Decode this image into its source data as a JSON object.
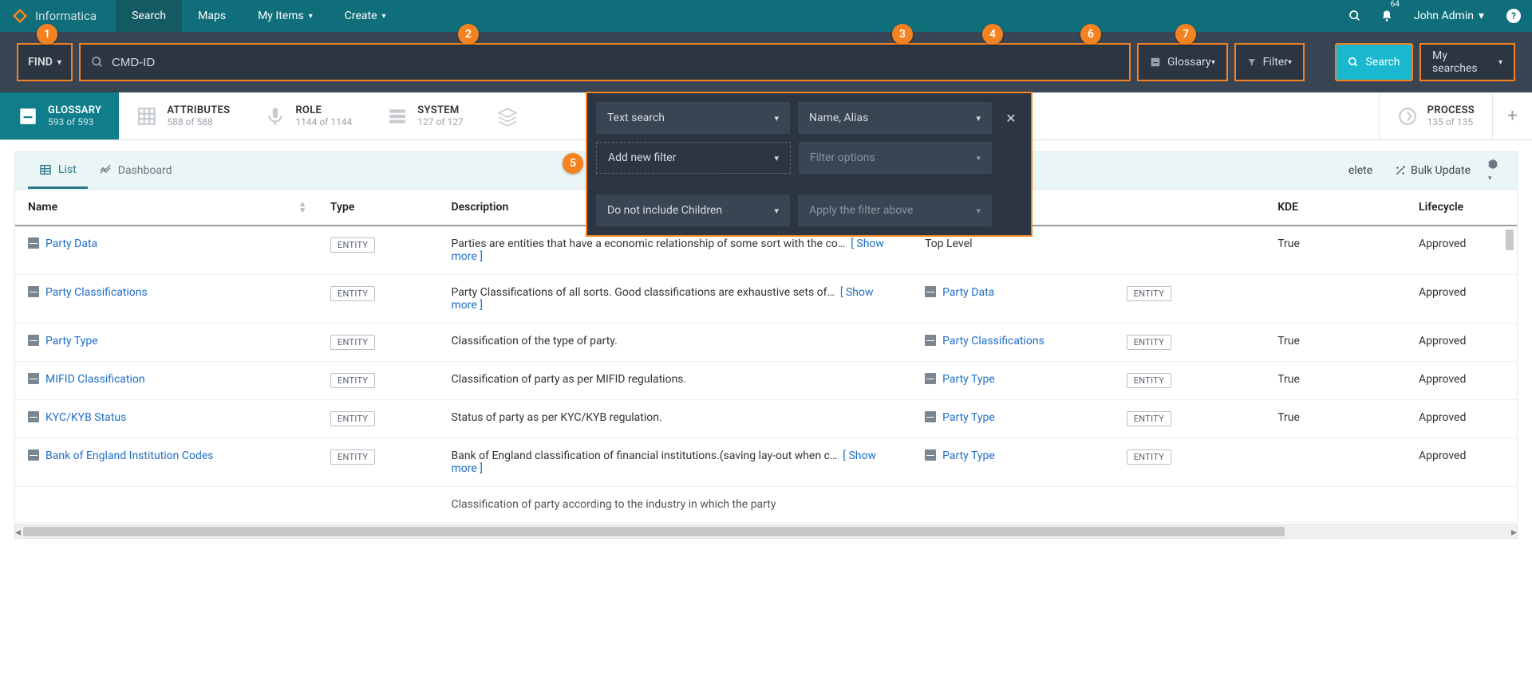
{
  "brand": "Informatica",
  "nav": {
    "search": "Search",
    "maps": "Maps",
    "myitems": "My Items",
    "create": "Create"
  },
  "notif_count": "64",
  "user_name": "John Admin",
  "searchbar": {
    "find": "FIND",
    "input_value": "CMD-ID",
    "glossary": "Glossary",
    "filter": "Filter",
    "search": "Search",
    "mysearches": "My searches"
  },
  "callouts": {
    "c1": "1",
    "c2": "2",
    "c3": "3",
    "c4": "4",
    "c5": "5",
    "c6": "6",
    "c7": "7"
  },
  "cats": {
    "glossary": {
      "title": "GLOSSARY",
      "sub": "593 of 593"
    },
    "attributes": {
      "title": "ATTRIBUTES",
      "sub": "588 of 588"
    },
    "role": {
      "title": "ROLE",
      "sub": "1144 of 1144"
    },
    "system": {
      "title": "SYSTEM",
      "sub": "127 of 127"
    },
    "process": {
      "title": "PROCESS",
      "sub": "135 of 135"
    }
  },
  "filter_panel": {
    "text_search": "Text search",
    "name_alias": "Name, Alias",
    "add_new_filter": "Add new filter",
    "filter_options": "Filter options",
    "do_not_include": "Do not include Children",
    "apply": "Apply the filter above"
  },
  "tabs": {
    "list": "List",
    "dashboard": "Dashboard",
    "delete": "elete",
    "bulk": "Bulk Update"
  },
  "cols": {
    "name": "Name",
    "type": "Type",
    "desc": "Description",
    "parent": "",
    "ptype": "",
    "kde": "KDE",
    "life": "Lifecycle"
  },
  "entity_label": "ENTITY",
  "showmore": "[ Show more ]",
  "rows": [
    {
      "name": "Party Data",
      "desc": "Parties are entities that have a economic relationship of some sort with the co…",
      "more": true,
      "parent": "Top Level",
      "parent_link": false,
      "ptype": "",
      "kde": "True",
      "life": "Approved"
    },
    {
      "name": "Party Classifications",
      "desc": "Party Classifications of all sorts. Good classifications are exhaustive sets of…",
      "more": true,
      "parent": "Party Data",
      "parent_link": true,
      "ptype": "ENTITY",
      "kde": "",
      "life": "Approved"
    },
    {
      "name": "Party Type",
      "desc": "Classification of the type of party.",
      "more": false,
      "parent": "Party Classifications",
      "parent_link": true,
      "ptype": "ENTITY",
      "kde": "True",
      "life": "Approved"
    },
    {
      "name": "MIFID Classification",
      "desc": "Classification of party as per MIFID regulations.",
      "more": false,
      "parent": "Party Type",
      "parent_link": true,
      "ptype": "ENTITY",
      "kde": "True",
      "life": "Approved"
    },
    {
      "name": "KYC/KYB Status",
      "desc": "Status of party as per KYC/KYB regulation.",
      "more": false,
      "parent": "Party Type",
      "parent_link": true,
      "ptype": "ENTITY",
      "kde": "True",
      "life": "Approved"
    },
    {
      "name": "Bank of England Institution Codes",
      "desc": "Bank of England classification of financial institutions.(saving lay-out when c…",
      "more": true,
      "parent": "Party Type",
      "parent_link": true,
      "ptype": "ENTITY",
      "kde": "",
      "life": "Approved"
    }
  ],
  "cutoff_desc": "Classification of party according to the industry in which the party"
}
